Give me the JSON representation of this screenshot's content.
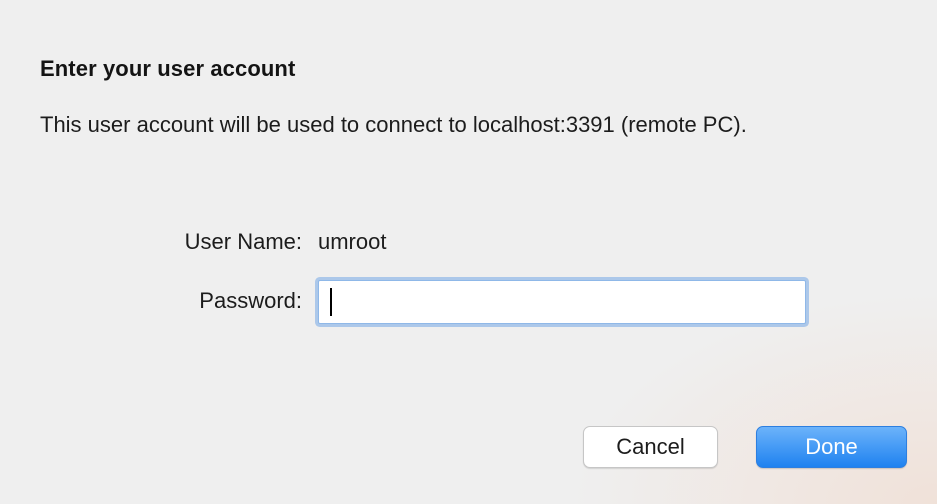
{
  "dialog": {
    "title": "Enter your user account",
    "message": "This user account will be used to connect to localhost:3391 (remote PC)."
  },
  "form": {
    "username_label": "User Name:",
    "username_value": "umroot",
    "password_label": "Password:",
    "password_value": ""
  },
  "buttons": {
    "cancel_label": "Cancel",
    "done_label": "Done"
  },
  "colors": {
    "accent": "#1f82f0",
    "focus_ring": "#74a7e6",
    "background": "#efefef"
  }
}
